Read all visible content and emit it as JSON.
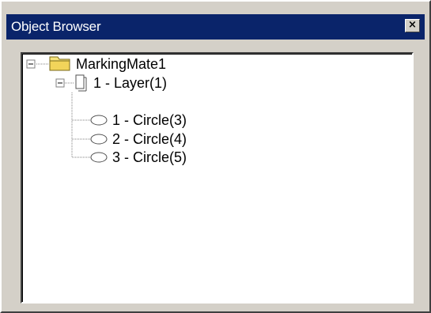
{
  "window": {
    "title": "Object Browser",
    "close_glyph": "×"
  },
  "tree": {
    "root": {
      "label": "MarkingMate1",
      "expander": "minus",
      "icon": "folder-icon",
      "children": [
        {
          "label": "1 - Layer(1)",
          "expander": "minus",
          "icon": "layer-page-icon",
          "children": [
            {
              "label": "1 - Circle(3)",
              "icon": "circle-icon"
            },
            {
              "label": "2 - Circle(4)",
              "icon": "circle-icon"
            },
            {
              "label": "3 - Circle(5)",
              "icon": "circle-icon"
            }
          ]
        }
      ]
    }
  },
  "colors": {
    "title_bar": "#0a246a",
    "face": "#d4d0c8",
    "folder_fill": "#f5e37a",
    "folder_edge": "#7a6a1a"
  }
}
